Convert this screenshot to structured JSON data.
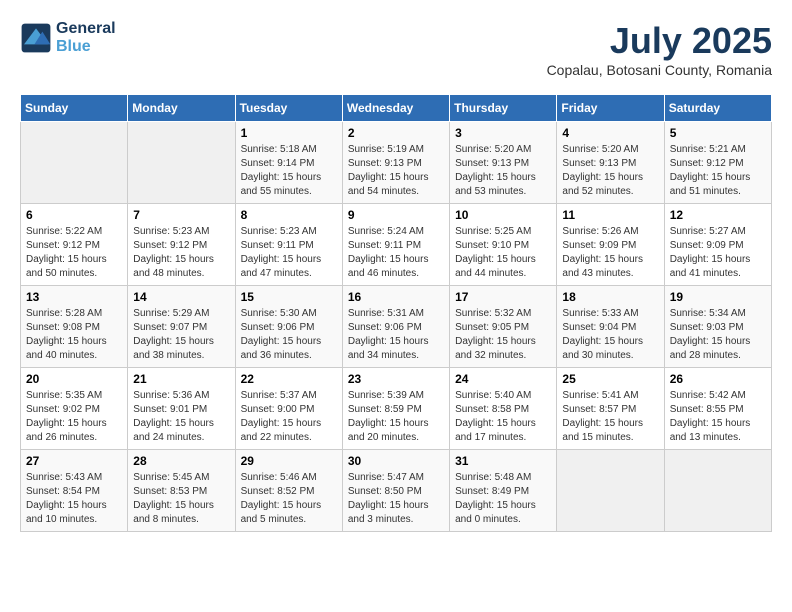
{
  "header": {
    "logo_line1": "General",
    "logo_line2": "Blue",
    "month_title": "July 2025",
    "subtitle": "Copalau, Botosani County, Romania"
  },
  "weekdays": [
    "Sunday",
    "Monday",
    "Tuesday",
    "Wednesday",
    "Thursday",
    "Friday",
    "Saturday"
  ],
  "weeks": [
    [
      {
        "day": "",
        "info": ""
      },
      {
        "day": "",
        "info": ""
      },
      {
        "day": "1",
        "info": "Sunrise: 5:18 AM\nSunset: 9:14 PM\nDaylight: 15 hours\nand 55 minutes."
      },
      {
        "day": "2",
        "info": "Sunrise: 5:19 AM\nSunset: 9:13 PM\nDaylight: 15 hours\nand 54 minutes."
      },
      {
        "day": "3",
        "info": "Sunrise: 5:20 AM\nSunset: 9:13 PM\nDaylight: 15 hours\nand 53 minutes."
      },
      {
        "day": "4",
        "info": "Sunrise: 5:20 AM\nSunset: 9:13 PM\nDaylight: 15 hours\nand 52 minutes."
      },
      {
        "day": "5",
        "info": "Sunrise: 5:21 AM\nSunset: 9:12 PM\nDaylight: 15 hours\nand 51 minutes."
      }
    ],
    [
      {
        "day": "6",
        "info": "Sunrise: 5:22 AM\nSunset: 9:12 PM\nDaylight: 15 hours\nand 50 minutes."
      },
      {
        "day": "7",
        "info": "Sunrise: 5:23 AM\nSunset: 9:12 PM\nDaylight: 15 hours\nand 48 minutes."
      },
      {
        "day": "8",
        "info": "Sunrise: 5:23 AM\nSunset: 9:11 PM\nDaylight: 15 hours\nand 47 minutes."
      },
      {
        "day": "9",
        "info": "Sunrise: 5:24 AM\nSunset: 9:11 PM\nDaylight: 15 hours\nand 46 minutes."
      },
      {
        "day": "10",
        "info": "Sunrise: 5:25 AM\nSunset: 9:10 PM\nDaylight: 15 hours\nand 44 minutes."
      },
      {
        "day": "11",
        "info": "Sunrise: 5:26 AM\nSunset: 9:09 PM\nDaylight: 15 hours\nand 43 minutes."
      },
      {
        "day": "12",
        "info": "Sunrise: 5:27 AM\nSunset: 9:09 PM\nDaylight: 15 hours\nand 41 minutes."
      }
    ],
    [
      {
        "day": "13",
        "info": "Sunrise: 5:28 AM\nSunset: 9:08 PM\nDaylight: 15 hours\nand 40 minutes."
      },
      {
        "day": "14",
        "info": "Sunrise: 5:29 AM\nSunset: 9:07 PM\nDaylight: 15 hours\nand 38 minutes."
      },
      {
        "day": "15",
        "info": "Sunrise: 5:30 AM\nSunset: 9:06 PM\nDaylight: 15 hours\nand 36 minutes."
      },
      {
        "day": "16",
        "info": "Sunrise: 5:31 AM\nSunset: 9:06 PM\nDaylight: 15 hours\nand 34 minutes."
      },
      {
        "day": "17",
        "info": "Sunrise: 5:32 AM\nSunset: 9:05 PM\nDaylight: 15 hours\nand 32 minutes."
      },
      {
        "day": "18",
        "info": "Sunrise: 5:33 AM\nSunset: 9:04 PM\nDaylight: 15 hours\nand 30 minutes."
      },
      {
        "day": "19",
        "info": "Sunrise: 5:34 AM\nSunset: 9:03 PM\nDaylight: 15 hours\nand 28 minutes."
      }
    ],
    [
      {
        "day": "20",
        "info": "Sunrise: 5:35 AM\nSunset: 9:02 PM\nDaylight: 15 hours\nand 26 minutes."
      },
      {
        "day": "21",
        "info": "Sunrise: 5:36 AM\nSunset: 9:01 PM\nDaylight: 15 hours\nand 24 minutes."
      },
      {
        "day": "22",
        "info": "Sunrise: 5:37 AM\nSunset: 9:00 PM\nDaylight: 15 hours\nand 22 minutes."
      },
      {
        "day": "23",
        "info": "Sunrise: 5:39 AM\nSunset: 8:59 PM\nDaylight: 15 hours\nand 20 minutes."
      },
      {
        "day": "24",
        "info": "Sunrise: 5:40 AM\nSunset: 8:58 PM\nDaylight: 15 hours\nand 17 minutes."
      },
      {
        "day": "25",
        "info": "Sunrise: 5:41 AM\nSunset: 8:57 PM\nDaylight: 15 hours\nand 15 minutes."
      },
      {
        "day": "26",
        "info": "Sunrise: 5:42 AM\nSunset: 8:55 PM\nDaylight: 15 hours\nand 13 minutes."
      }
    ],
    [
      {
        "day": "27",
        "info": "Sunrise: 5:43 AM\nSunset: 8:54 PM\nDaylight: 15 hours\nand 10 minutes."
      },
      {
        "day": "28",
        "info": "Sunrise: 5:45 AM\nSunset: 8:53 PM\nDaylight: 15 hours\nand 8 minutes."
      },
      {
        "day": "29",
        "info": "Sunrise: 5:46 AM\nSunset: 8:52 PM\nDaylight: 15 hours\nand 5 minutes."
      },
      {
        "day": "30",
        "info": "Sunrise: 5:47 AM\nSunset: 8:50 PM\nDaylight: 15 hours\nand 3 minutes."
      },
      {
        "day": "31",
        "info": "Sunrise: 5:48 AM\nSunset: 8:49 PM\nDaylight: 15 hours\nand 0 minutes."
      },
      {
        "day": "",
        "info": ""
      },
      {
        "day": "",
        "info": ""
      }
    ]
  ]
}
